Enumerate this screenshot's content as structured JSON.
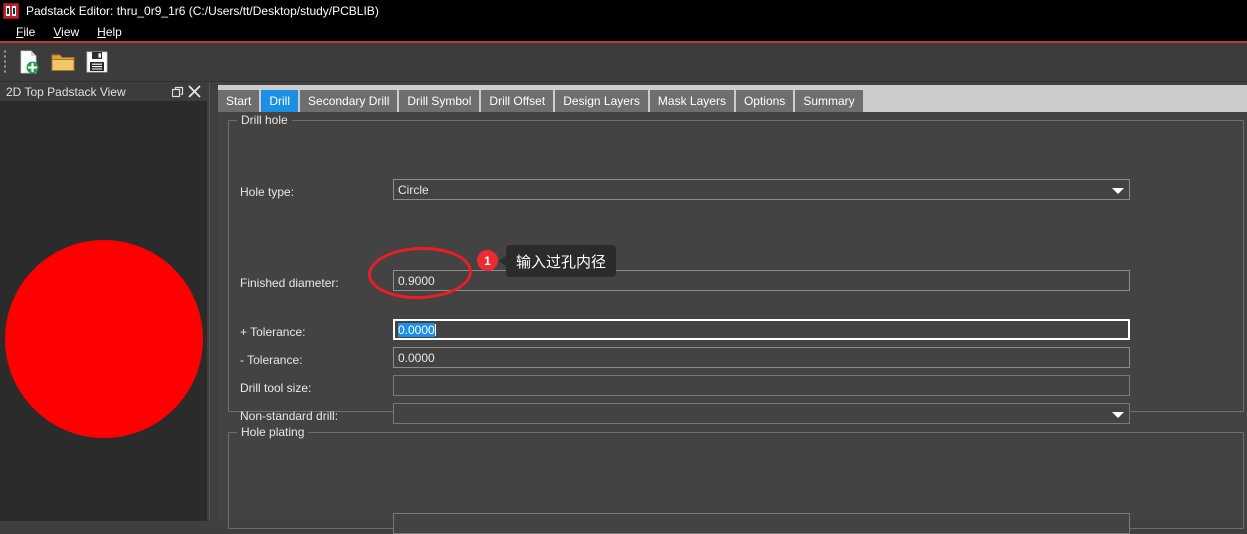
{
  "window": {
    "title": "Padstack Editor: thru_0r9_1r6  (C:/Users/tt/Desktop/study/PCBLIB)",
    "icon": "padstack-app-icon"
  },
  "menubar": {
    "items": [
      {
        "mnemonic": "F",
        "rest": "ile"
      },
      {
        "mnemonic": "V",
        "rest": "iew"
      },
      {
        "mnemonic": "H",
        "rest": "elp"
      }
    ]
  },
  "toolbar": {
    "buttons": [
      {
        "name": "new-padstack-icon",
        "title": "New"
      },
      {
        "name": "open-folder-icon",
        "title": "Open"
      },
      {
        "name": "save-icon",
        "title": "Save"
      }
    ]
  },
  "dock": {
    "title": "2D Top Padstack View",
    "float_icon": "restore-window-icon",
    "close_icon": "close-icon",
    "pad_color": "#fe0000"
  },
  "tabs": [
    {
      "label": "Start",
      "active": false
    },
    {
      "label": "Drill",
      "active": true
    },
    {
      "label": "Secondary Drill",
      "active": false
    },
    {
      "label": "Drill Symbol",
      "active": false
    },
    {
      "label": "Drill Offset",
      "active": false
    },
    {
      "label": "Design Layers",
      "active": false
    },
    {
      "label": "Mask Layers",
      "active": false
    },
    {
      "label": "Options",
      "active": false
    },
    {
      "label": "Summary",
      "active": false
    }
  ],
  "groups": {
    "drill_hole": {
      "title": "Drill hole"
    },
    "hole_plating": {
      "title": "Hole plating"
    }
  },
  "fields": {
    "hole_type": {
      "label": "Hole type:",
      "value": "Circle",
      "type": "combobox"
    },
    "finished_diameter": {
      "label": "Finished diameter:",
      "value": "0.9000",
      "type": "text"
    },
    "plus_tolerance": {
      "label": "+ Tolerance:",
      "value": "0.0000",
      "type": "text",
      "focused": true,
      "selected": true
    },
    "minus_tolerance": {
      "label": "- Tolerance:",
      "value": "0.0000",
      "type": "text"
    },
    "drill_tool_size": {
      "label": "Drill tool size:",
      "value": "",
      "type": "text"
    },
    "non_standard_drill": {
      "label": "Non-standard drill:",
      "value": "",
      "type": "combobox"
    },
    "plating_field": {
      "label": "",
      "value": "",
      "type": "text"
    }
  },
  "annotation": {
    "badge_number": "1",
    "tooltip_text": "输入过孔内径",
    "highlight_color": "#ee1c25",
    "badge_color": "#ee2b34"
  },
  "theme": {
    "accent": "#1a8fe3",
    "titlebar_bg": "#000000",
    "panel_bg": "#434343",
    "dock_bg": "#2b2b2b",
    "tabstrip_bg": "#cccccc"
  }
}
